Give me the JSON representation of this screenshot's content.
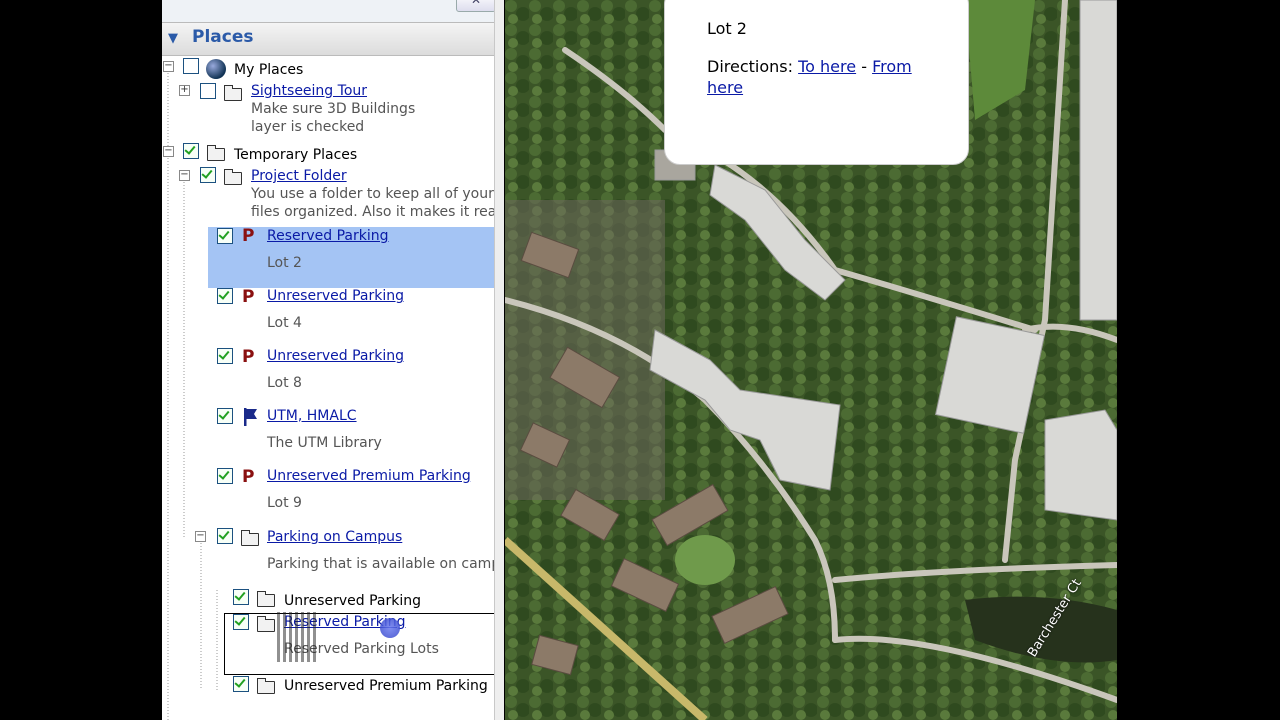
{
  "panel": {
    "title": "Places",
    "close_label": "✕"
  },
  "tree": {
    "my_places": {
      "label": "My Places"
    },
    "sightseeing": {
      "label": "Sightseeing Tour",
      "desc1": "Make sure 3D Buildings",
      "desc2": "layer is checked"
    },
    "temporary": {
      "label": "Temporary Places"
    },
    "project": {
      "label": "Project Folder",
      "desc1": "You use a folder to keep all of your",
      "desc2": "files organized. Also it makes it really"
    },
    "items": [
      {
        "label": "Reserved Parking",
        "desc": "Lot 2"
      },
      {
        "label": "Unreserved Parking",
        "desc": "Lot 4"
      },
      {
        "label": "Unreserved Parking",
        "desc": "Lot 8"
      },
      {
        "label": "UTM, HMALC",
        "desc": "The UTM Library"
      },
      {
        "label": "Unreserved Premium Parking",
        "desc": "Lot 9"
      }
    ],
    "parking_campus": {
      "label": "Parking on Campus",
      "desc": "Parking that is available on campus"
    },
    "sub": [
      {
        "label": "Unreserved Parking"
      },
      {
        "label": "Reserved Parking",
        "desc": "Reserved Parking Lots"
      },
      {
        "label": "Unreserved Premium Parking"
      }
    ]
  },
  "balloon": {
    "title": "Lot 2",
    "directions_label": "Directions:",
    "to_here": "To here",
    "separator": "-",
    "from_here": "From here"
  },
  "map": {
    "street_label": "Barchester Ct"
  },
  "colors": {
    "selection": "#a4c4f4",
    "link": "#0a1aa6",
    "header_text": "#2b5aa8"
  }
}
